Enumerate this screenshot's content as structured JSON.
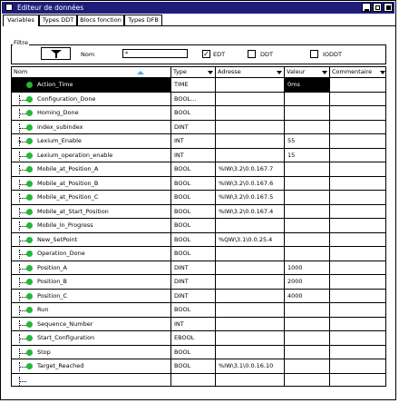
{
  "window": {
    "title": "Editeur de données",
    "colors": {
      "titlebar": "#1e1e7a",
      "status_dot": "#23b83a",
      "sort_arrow": "#4aa9e8"
    }
  },
  "tabs": [
    {
      "label": "Variables",
      "active": true
    },
    {
      "label": "Types DDT",
      "active": false
    },
    {
      "label": "Blocs fonction",
      "active": false
    },
    {
      "label": "Types DFB",
      "active": false
    }
  ],
  "filter": {
    "group_label": "Filtre",
    "funnel_icon": "funnel-icon",
    "name_label": "Nom",
    "name_value": "*",
    "checkboxes": [
      {
        "label": "EDT",
        "checked": true
      },
      {
        "label": "DDT",
        "checked": false
      },
      {
        "label": "IODDT",
        "checked": false
      }
    ]
  },
  "columns": {
    "name": "Nom",
    "type": "Type",
    "address": "Adresse",
    "value": "Valeur",
    "comment": "Commentaire"
  },
  "rows": [
    {
      "name": "Action_Time",
      "type": "TIME",
      "address": "",
      "value": "0ms",
      "comment": "",
      "expand": "",
      "selected": true
    },
    {
      "name": "Configuration_Done",
      "type": "BOOL...",
      "address": "",
      "value": "",
      "comment": "",
      "expand": ""
    },
    {
      "name": "Homing_Done",
      "type": "BOOL",
      "address": "",
      "value": "",
      "comment": "",
      "expand": ""
    },
    {
      "name": "index_subindex",
      "type": "DINT",
      "address": "",
      "value": "",
      "comment": "",
      "expand": ""
    },
    {
      "name": "Lexium_Enable",
      "type": "INT",
      "address": "",
      "value": "55",
      "comment": "",
      "expand": "+"
    },
    {
      "name": "Lexium_operation_enable",
      "type": "INT",
      "address": "",
      "value": "15",
      "comment": "",
      "expand": ""
    },
    {
      "name": "Mobile_at_Position_A",
      "type": "BOOL",
      "address": "%IW\\3.2\\0.0.167.7",
      "value": "",
      "comment": "",
      "expand": ""
    },
    {
      "name": "Mobile_at_Position_B",
      "type": "BOOL",
      "address": "%IW\\3.2\\0.0.167.6",
      "value": "",
      "comment": "",
      "expand": ""
    },
    {
      "name": "Mobile_at_Position_C",
      "type": "BOOL",
      "address": "%IW\\3.2\\0.0.167.5",
      "value": "",
      "comment": "",
      "expand": ""
    },
    {
      "name": "Mobile_at_Start_Position",
      "type": "BOOL",
      "address": "%IW\\3.2\\0.0.167.4",
      "value": "",
      "comment": "",
      "expand": ""
    },
    {
      "name": "Mobile_In_Progress",
      "type": "BOOL",
      "address": "",
      "value": "",
      "comment": "",
      "expand": ""
    },
    {
      "name": "New_SetPoint",
      "type": "BOOL",
      "address": "%QW\\3.1\\0.0.25.4",
      "value": "",
      "comment": "",
      "expand": ""
    },
    {
      "name": "Operation_Done",
      "type": "BOOL",
      "address": "",
      "value": "",
      "comment": "",
      "expand": ""
    },
    {
      "name": "Position_A",
      "type": "DINT",
      "address": "",
      "value": "1000",
      "comment": "",
      "expand": ""
    },
    {
      "name": "Position_B",
      "type": "DINT",
      "address": "",
      "value": "2000",
      "comment": "",
      "expand": ""
    },
    {
      "name": "Position_C",
      "type": "DINT",
      "address": "",
      "value": "4000",
      "comment": "",
      "expand": ""
    },
    {
      "name": "Run",
      "type": "BOOL",
      "address": "",
      "value": "",
      "comment": "",
      "expand": ""
    },
    {
      "name": "Sequence_Number",
      "type": "INT",
      "address": "",
      "value": "",
      "comment": "",
      "expand": ""
    },
    {
      "name": "Start_Configuration",
      "type": "EBOOL",
      "address": "",
      "value": "",
      "comment": "",
      "expand": ""
    },
    {
      "name": "Stop",
      "type": "BOOL",
      "address": "",
      "value": "",
      "comment": "",
      "expand": ""
    },
    {
      "name": "Target_Reached",
      "type": "BOOL",
      "address": "%IW\\3.1\\0.0.16.10",
      "value": "",
      "comment": "",
      "expand": ""
    }
  ]
}
